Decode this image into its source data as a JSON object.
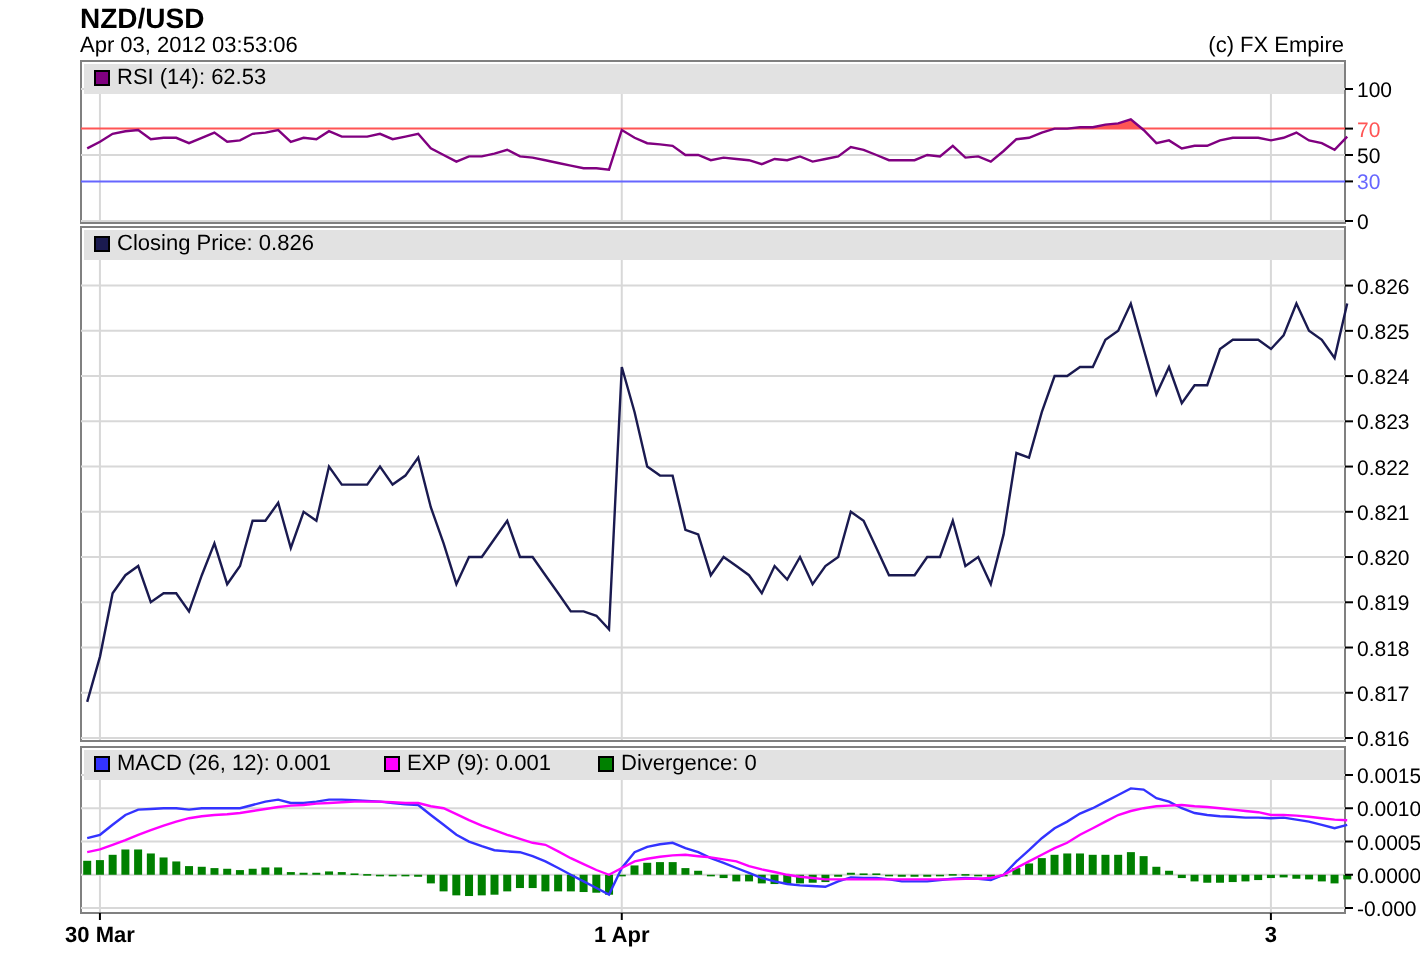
{
  "header": {
    "title": "NZD/USD",
    "timestamp": "Apr 03, 2012 03:53:06",
    "credit": "(c) FX Empire"
  },
  "panels": [
    {
      "chart_data": {
        "type": "line",
        "grid": true,
        "ylim": [
          0,
          100
        ],
        "yticks": [
          0,
          50,
          100
        ],
        "ref_lines": [
          {
            "axis": "y",
            "value": 70,
            "label": "70",
            "color": "#ff5555"
          },
          {
            "axis": "y",
            "value": 30,
            "label": "30",
            "color": "#6666ff"
          }
        ],
        "series": [
          {
            "name": "RSI (14): 62.53",
            "color": "#800080",
            "values": [
              55,
              60,
              66,
              68,
              69,
              62,
              63,
              63,
              59,
              63,
              67,
              60,
              61,
              66,
              67,
              69,
              60,
              63,
              62,
              68,
              64,
              64,
              64,
              66,
              62,
              64,
              66,
              55,
              50,
              45,
              49,
              49,
              51,
              54,
              49,
              48,
              46,
              44,
              42,
              40,
              40,
              39,
              69,
              63,
              59,
              58,
              57,
              50,
              50,
              46,
              48,
              47,
              46,
              43,
              47,
              46,
              49,
              45,
              47,
              49,
              56,
              54,
              50,
              46,
              46,
              46,
              50,
              49,
              57,
              48,
              49,
              45,
              53,
              62,
              63,
              67,
              70,
              70,
              71,
              71,
              73,
              74,
              77,
              69,
              59,
              61,
              55,
              57,
              57,
              61,
              63,
              63,
              63,
              61,
              63,
              67,
              61,
              59,
              54,
              64
            ]
          }
        ]
      }
    },
    {
      "chart_data": {
        "type": "line",
        "grid": true,
        "ylim": [
          0.816,
          0.826
        ],
        "yticks": [
          {
            "value": 0.816,
            "label": "0.816"
          },
          {
            "value": 0.817,
            "label": "0.817"
          },
          {
            "value": 0.818,
            "label": "0.818"
          },
          {
            "value": 0.819,
            "label": "0.819"
          },
          {
            "value": 0.82,
            "label": "0.820"
          },
          {
            "value": 0.821,
            "label": "0.821"
          },
          {
            "value": 0.822,
            "label": "0.822"
          },
          {
            "value": 0.823,
            "label": "0.823"
          },
          {
            "value": 0.824,
            "label": "0.824"
          },
          {
            "value": 0.825,
            "label": "0.825"
          },
          {
            "value": 0.826,
            "label": "0.826"
          }
        ],
        "series": [
          {
            "name": "Closing Price: 0.826",
            "color": "#1a1a50",
            "values": [
              0.8168,
              0.8178,
              0.8192,
              0.8196,
              0.8198,
              0.819,
              0.8192,
              0.8192,
              0.8188,
              0.8196,
              0.8203,
              0.8194,
              0.8198,
              0.8208,
              0.8208,
              0.8212,
              0.8202,
              0.821,
              0.8208,
              0.822,
              0.8216,
              0.8216,
              0.8216,
              0.822,
              0.8216,
              0.8218,
              0.8222,
              0.8211,
              0.8203,
              0.8194,
              0.82,
              0.82,
              0.8204,
              0.8208,
              0.82,
              0.82,
              0.8196,
              0.8192,
              0.8188,
              0.8188,
              0.8187,
              0.8184,
              0.8242,
              0.8232,
              0.822,
              0.8218,
              0.8218,
              0.8206,
              0.8205,
              0.8196,
              0.82,
              0.8198,
              0.8196,
              0.8192,
              0.8198,
              0.8195,
              0.82,
              0.8194,
              0.8198,
              0.82,
              0.821,
              0.8208,
              0.8202,
              0.8196,
              0.8196,
              0.8196,
              0.82,
              0.82,
              0.8208,
              0.8198,
              0.82,
              0.8194,
              0.8205,
              0.8223,
              0.8222,
              0.8232,
              0.824,
              0.824,
              0.8242,
              0.8242,
              0.8248,
              0.825,
              0.8256,
              0.8246,
              0.8236,
              0.8242,
              0.8234,
              0.8238,
              0.8238,
              0.8246,
              0.8248,
              0.8248,
              0.8248,
              0.8246,
              0.8249,
              0.8256,
              0.825,
              0.8248,
              0.8244,
              0.8256
            ]
          }
        ]
      }
    },
    {
      "chart_data": {
        "type": "line",
        "grid": true,
        "categories": [
          null,
          "30 Mar",
          null,
          null,
          null,
          null,
          null,
          null,
          null,
          null,
          null,
          null,
          null,
          null,
          null,
          null,
          null,
          null,
          null,
          null,
          null,
          null,
          null,
          null,
          null,
          null,
          null,
          null,
          null,
          null,
          null,
          null,
          null,
          null,
          null,
          null,
          null,
          null,
          null,
          null,
          null,
          null,
          "1 Apr",
          null,
          null,
          null,
          null,
          null,
          null,
          null,
          null,
          null,
          null,
          null,
          null,
          null,
          null,
          null,
          null,
          null,
          null,
          null,
          null,
          null,
          null,
          null,
          null,
          null,
          null,
          null,
          null,
          null,
          null,
          null,
          null,
          null,
          null,
          null,
          null,
          null,
          null,
          null,
          null,
          null,
          null,
          null,
          null,
          null,
          null,
          null,
          null,
          null,
          null,
          "3",
          null,
          null,
          null,
          null,
          null,
          null
        ],
        "ylim": [
          -0.0005,
          0.0015
        ],
        "yticks": [
          {
            "value": -0.0005,
            "label": "-0.000"
          },
          {
            "value": 0,
            "label": "0.0000"
          },
          {
            "value": 0.0005,
            "label": "0.0005"
          },
          {
            "value": 0.001,
            "label": "0.0010"
          },
          {
            "value": 0.0015,
            "label": "0.0015"
          }
        ],
        "series": [
          {
            "name": "MACD (26, 12): 0.001",
            "color": "#3333ff",
            "values": [
              0.00055,
              0.0006,
              0.00075,
              0.0009,
              0.00098,
              0.00099,
              0.001,
              0.001,
              0.00098,
              0.001,
              0.001,
              0.001,
              0.001,
              0.00105,
              0.0011,
              0.00113,
              0.00108,
              0.00108,
              0.0011,
              0.00113,
              0.00113,
              0.00112,
              0.00111,
              0.0011,
              0.00108,
              0.00106,
              0.00105,
              0.0009,
              0.00075,
              0.0006,
              0.0005,
              0.00043,
              0.00037,
              0.00035,
              0.00034,
              0.00028,
              0.0002,
              0.0001,
              0,
              -0.0001,
              -0.0002,
              -0.0003,
              0.0001,
              0.00034,
              0.00042,
              0.00046,
              0.00048,
              0.0004,
              0.00034,
              0.00025,
              0.00018,
              0.0001,
              3e-05,
              -5e-05,
              -0.0001,
              -0.00014,
              -0.00016,
              -0.00017,
              -0.00018,
              -0.0001,
              -4e-05,
              -5e-05,
              -5e-05,
              -7e-05,
              -0.0001,
              -0.0001,
              -0.0001,
              -8e-05,
              -6e-05,
              -5e-05,
              -6e-05,
              -8e-05,
              0,
              0.0002,
              0.00037,
              0.00055,
              0.0007,
              0.0008,
              0.00092,
              0.001,
              0.0011,
              0.0012,
              0.0013,
              0.00128,
              0.00115,
              0.0011,
              0.001,
              0.00093,
              0.0009,
              0.00088,
              0.00087,
              0.00086,
              0.00086,
              0.00085,
              0.00086,
              0.00083,
              0.0008,
              0.00075,
              0.0007,
              0.00075
            ]
          },
          {
            "name": "EXP (9): 0.001",
            "color": "#ff00ff",
            "values": [
              0.00034,
              0.00038,
              0.00045,
              0.00052,
              0.0006,
              0.00067,
              0.00074,
              0.0008,
              0.00085,
              0.00088,
              0.0009,
              0.00091,
              0.00093,
              0.00096,
              0.00099,
              0.00102,
              0.00104,
              0.00105,
              0.00107,
              0.00108,
              0.00109,
              0.0011,
              0.0011,
              0.0011,
              0.00109,
              0.00108,
              0.00108,
              0.00103,
              0.001,
              0.00091,
              0.00082,
              0.00074,
              0.00067,
              0.0006,
              0.00054,
              0.00048,
              0.00045,
              0.00035,
              0.00025,
              0.00016,
              7e-05,
              0,
              0.0001,
              0.0002,
              0.00024,
              0.00027,
              0.00029,
              0.0003,
              0.00028,
              0.00026,
              0.00023,
              0.0002,
              0.00013,
              8e-05,
              4e-05,
              0,
              -3e-05,
              -5e-05,
              -7e-05,
              -7e-05,
              -7e-05,
              -7e-05,
              -7e-05,
              -7e-05,
              -7e-05,
              -7e-05,
              -7e-05,
              -7e-05,
              -7e-05,
              -6e-05,
              -6e-05,
              -5e-05,
              0,
              0.0001,
              0.0002,
              0.0003,
              0.0004,
              0.00048,
              0.0006,
              0.0007,
              0.0008,
              0.0009,
              0.00096,
              0.001,
              0.00103,
              0.00104,
              0.00105,
              0.00103,
              0.00102,
              0.001,
              0.00098,
              0.00096,
              0.00094,
              0.0009,
              0.0009,
              0.00089,
              0.00087,
              0.00085,
              0.00083,
              0.00082
            ]
          },
          {
            "name": "Divergence: 0",
            "type": "bar",
            "color": "#008000",
            "values": [
              0.00021,
              0.00022,
              0.0003,
              0.00038,
              0.00038,
              0.00032,
              0.00026,
              0.0002,
              0.00013,
              0.00012,
              0.0001,
              9e-05,
              7e-05,
              9e-05,
              0.00011,
              0.00011,
              4e-05,
              3e-05,
              3e-05,
              5e-05,
              4e-05,
              2e-05,
              1e-05,
              0,
              -1e-05,
              -2e-05,
              -3e-05,
              -0.00013,
              -0.00025,
              -0.00031,
              -0.00032,
              -0.00031,
              -0.0003,
              -0.00025,
              -0.0002,
              -0.0002,
              -0.00025,
              -0.00025,
              -0.00025,
              -0.00026,
              -0.00027,
              -0.0003,
              0,
              0.00014,
              0.00018,
              0.00019,
              0.00019,
              0.0001,
              6e-05,
              -1e-05,
              -5e-05,
              -0.0001,
              -0.0001,
              -0.00013,
              -0.00014,
              -0.00014,
              -0.00013,
              -0.00012,
              -0.00011,
              -3e-05,
              3e-05,
              2e-05,
              2e-05,
              0,
              -3e-05,
              -3e-05,
              -3e-05,
              -1e-05,
              1e-05,
              1e-05,
              0,
              -3e-05,
              0,
              0.0001,
              0.00017,
              0.00025,
              0.0003,
              0.00032,
              0.00032,
              0.0003,
              0.0003,
              0.0003,
              0.00034,
              0.00028,
              0.00012,
              6e-05,
              -5e-05,
              -0.0001,
              -0.00012,
              -0.00012,
              -0.00011,
              -0.0001,
              -8e-05,
              -5e-05,
              -4e-05,
              -6e-05,
              -7e-05,
              -0.0001,
              -0.00013,
              -7e-05
            ]
          }
        ]
      }
    }
  ]
}
